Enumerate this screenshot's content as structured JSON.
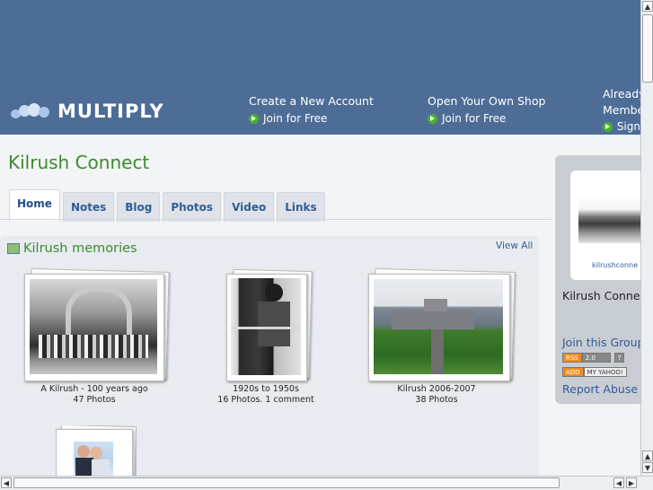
{
  "header": {
    "logo_text": "MULTIPLY",
    "col1": {
      "title": "Create a New Account",
      "link": "Join for Free"
    },
    "col2": {
      "title": "Open Your Own Shop",
      "link": "Join for Free"
    },
    "col3": {
      "title_line1": "Already",
      "title_line2": "Membe",
      "link": "Sign"
    }
  },
  "site_title": "Kilrush Connect",
  "tabs": [
    {
      "label": "Home",
      "active": true
    },
    {
      "label": "Notes"
    },
    {
      "label": "Blog"
    },
    {
      "label": "Photos"
    },
    {
      "label": "Video"
    },
    {
      "label": "Links"
    }
  ],
  "section": {
    "title": "Kilrush memories",
    "view_all": "View All"
  },
  "albums": [
    {
      "title": "A Kilrush - 100 years ago",
      "subtitle": "47 Photos"
    },
    {
      "title": "1920s to 1950s",
      "subtitle": "16 Photos. 1 comment"
    },
    {
      "title": "Kilrush 2006-2007",
      "subtitle": "38 Photos"
    }
  ],
  "sidebar": {
    "photo_caption": "kilrushconne",
    "group_name": "Kilrush Connec",
    "join_link": "Join this Group",
    "rss_badge": [
      "RSS",
      "2.0",
      "?"
    ],
    "yahoo_badge": [
      "ADD",
      "MY YAHOO!"
    ],
    "report_link": "Report Abuse"
  },
  "colors": {
    "header_bg": "#4d6d97",
    "title_green": "#3b8a2e",
    "link_blue": "#2f5d95"
  }
}
